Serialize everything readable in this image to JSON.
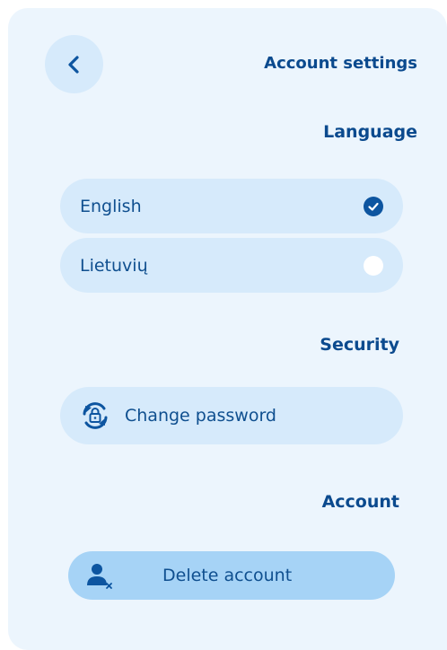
{
  "header": {
    "back_icon": "chevron-left-icon",
    "title": "Account settings"
  },
  "language": {
    "section_title": "Language",
    "options": [
      {
        "label": "English",
        "selected": true
      },
      {
        "label": "Lietuvių",
        "selected": false
      }
    ]
  },
  "security": {
    "section_title": "Security",
    "change_password_label": "Change password",
    "change_password_icon": "lock-refresh-icon"
  },
  "account": {
    "section_title": "Account",
    "delete_label": "Delete account",
    "delete_icon": "user-remove-icon"
  },
  "colors": {
    "panel_bg": "#ecf5fd",
    "pill_bg": "#d6eafb",
    "accent": "#0d55a0",
    "title_text": "#0b4a8e",
    "delete_bg": "#a6d3f6"
  }
}
